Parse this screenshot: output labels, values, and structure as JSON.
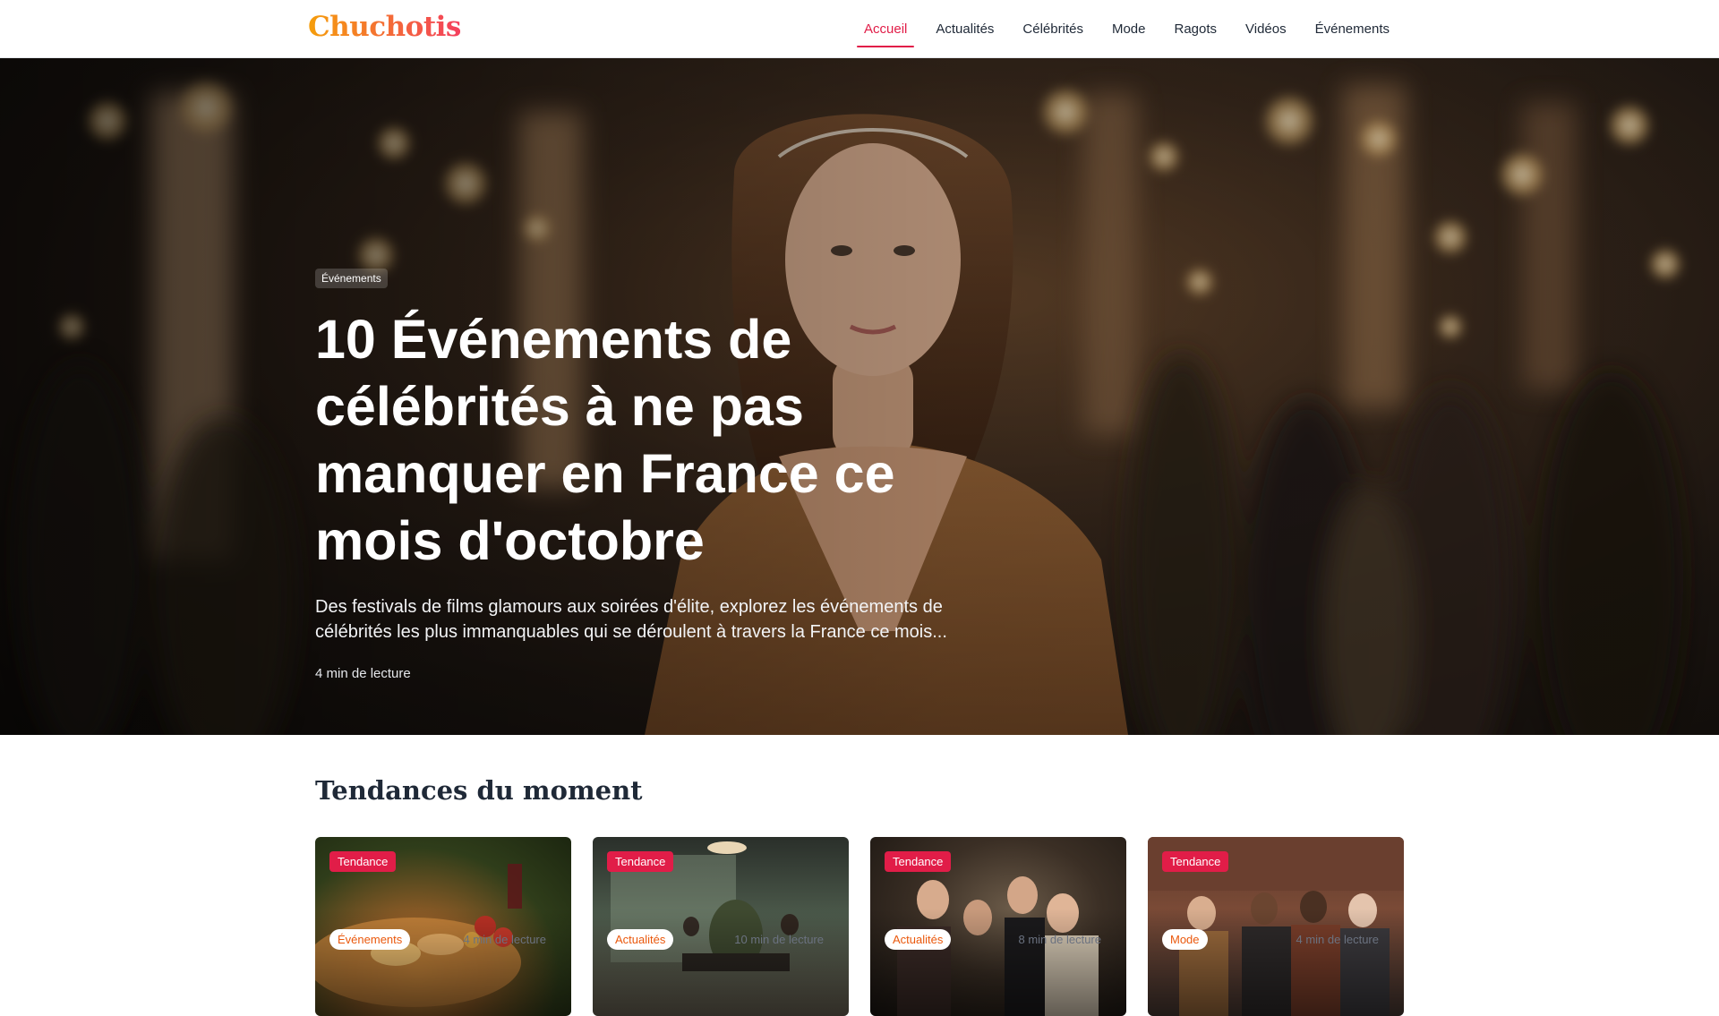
{
  "header": {
    "logo": "Chuchotis",
    "nav": [
      {
        "label": "Accueil",
        "active": true
      },
      {
        "label": "Actualités"
      },
      {
        "label": "Célébrités"
      },
      {
        "label": "Mode"
      },
      {
        "label": "Ragots"
      },
      {
        "label": "Vidéos"
      },
      {
        "label": "Événements"
      }
    ]
  },
  "hero": {
    "category": "Événements",
    "title": "10 Événements de célébrités à ne pas manquer en France ce mois d'octobre",
    "subtitle": "Des festivals de films glamours aux soirées d'élite, explorez les événements de célébrités les plus immanquables qui se déroulent à travers la France ce mois...",
    "read_time": "4 min de lecture"
  },
  "trending": {
    "title": "Tendances du moment",
    "cards": [
      {
        "badge": "Tendance",
        "category": "Événements",
        "read_time": "4 min de lecture"
      },
      {
        "badge": "Tendance",
        "category": "Actualités",
        "read_time": "10 min de lecture"
      },
      {
        "badge": "Tendance",
        "category": "Actualités",
        "read_time": "8 min de lecture"
      },
      {
        "badge": "Tendance",
        "category": "Mode",
        "read_time": "4 min de lecture"
      }
    ]
  },
  "colors": {
    "accent": "#e11d48",
    "logo_gradient_start": "#f59e0b",
    "logo_gradient_end": "#f43f5e",
    "category_text": "#ea580c"
  }
}
